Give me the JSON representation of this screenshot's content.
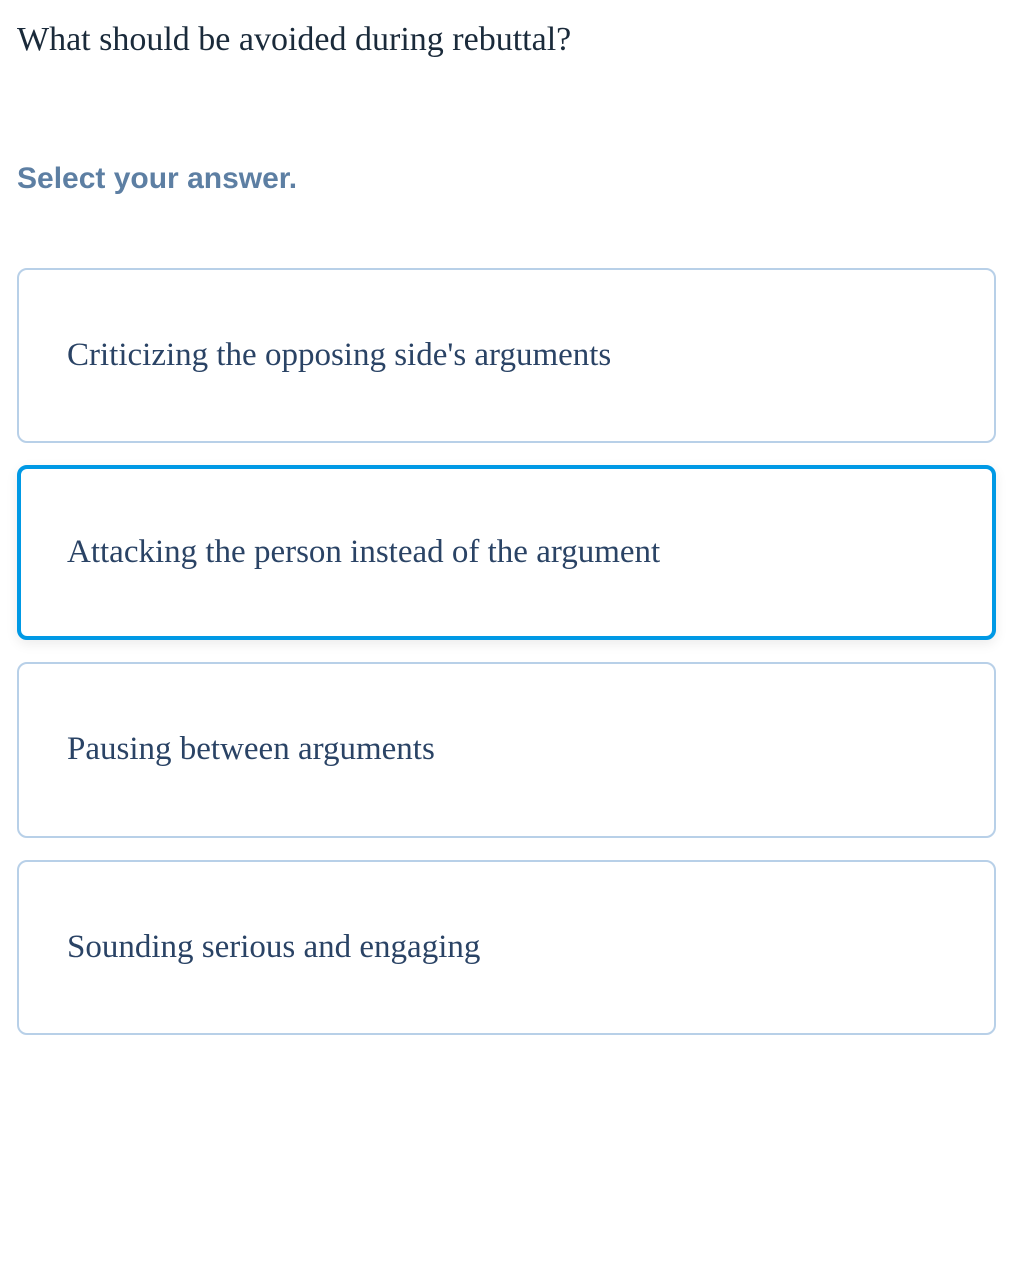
{
  "question": {
    "text": "What should be avoided during rebuttal?",
    "instruction": "Select your answer."
  },
  "options": [
    {
      "text": "Criticizing the opposing side's arguments",
      "selected": false
    },
    {
      "text": "Attacking the person instead of the argument",
      "selected": true
    },
    {
      "text": "Pausing between arguments",
      "selected": false
    },
    {
      "text": "Sounding serious and engaging",
      "selected": false
    }
  ]
}
